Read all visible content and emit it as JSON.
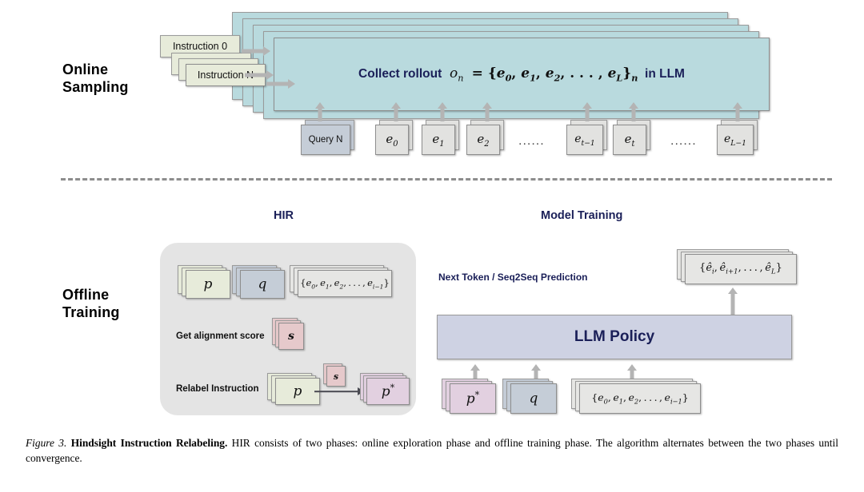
{
  "figure": {
    "caption_number": "Figure 3.",
    "caption_title": "Hindsight Instruction Relabeling.",
    "caption_body": "HIR consists of two phases: online exploration phase and offline training phase. The algorithm alternates between the two phases until convergence."
  },
  "colors": {
    "teal": "#b9dade",
    "green": "#e7ebda",
    "blue_gray": "#c5cdd7",
    "grey": "#e2e2e0",
    "pink": "#e6c9cb",
    "mauve": "#e2d0e0",
    "lavender": "#ced2e3",
    "panel_grey": "#e4e4e4",
    "heading_navy": "#1a1f58",
    "arrow_grey": "#b4b4b4",
    "arrow_dark": "#4a4a52"
  },
  "sections": {
    "online": {
      "side_label_line1": "Online",
      "side_label_line2": "Sampling",
      "instruction_first": "Instruction 0",
      "instruction_last": "Instruction N",
      "rollout_prefix": "Collect rollout",
      "rollout_formula": "o_n = {e_0, e_1, e_2, ..., e_L}_n",
      "rollout_suffix": "in LLM",
      "query_label": "Query N",
      "tokens": [
        {
          "label": "e_0",
          "base": "e",
          "sub": "0"
        },
        {
          "label": "e_1",
          "base": "e",
          "sub": "1"
        },
        {
          "label": "e_2",
          "base": "e",
          "sub": "2"
        },
        {
          "label": "e_t-1",
          "base": "e",
          "sub": "t−1"
        },
        {
          "label": "e_t",
          "base": "e",
          "sub": "t"
        },
        {
          "label": "e_L-1",
          "base": "e",
          "sub": "L−1"
        }
      ],
      "ellipsis": "......"
    },
    "offline": {
      "side_label_line1": "Offline",
      "side_label_line2": "Training",
      "hir": {
        "heading": "HIR",
        "box_p": "p",
        "box_q": "q",
        "box_seq": "{e_0, e_1, e_2, ..., e_i-1}",
        "row_align_label": "Get alignment score",
        "box_s": "s",
        "row_relabel_label": "Relabel Instruction",
        "box_p_in": "p",
        "box_s_small": "s",
        "box_p_star": "p*"
      },
      "model_training": {
        "heading": "Model Training",
        "prediction_label": "Next Token / Seq2Seq Prediction",
        "output_box": "{ê_i, ê_i+1, ..., ê_L}",
        "policy_bar": "LLM Policy",
        "input_p_star": "p*",
        "input_q": "q",
        "input_seq": "{e_0, e_1, e_2, ..., e_i-1}"
      }
    }
  }
}
